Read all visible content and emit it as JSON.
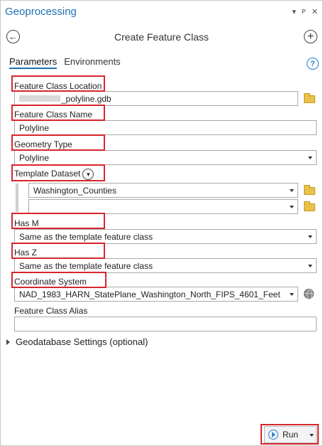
{
  "window": {
    "title": "Geoprocessing",
    "controls": [
      "▾",
      "ᴘ",
      "✕"
    ]
  },
  "header": {
    "tool_title": "Create Feature Class"
  },
  "tabs": [
    {
      "label": "Parameters",
      "active": true
    },
    {
      "label": "Environments",
      "active": false
    }
  ],
  "help_label": "?",
  "params": {
    "location_label": "Feature Class Location",
    "location_value": "_polyline.gdb",
    "name_label": "Feature Class Name",
    "name_value": "Polyline",
    "geometry_label": "Geometry Type",
    "geometry_value": "Polyline",
    "template_label": "Template Dataset",
    "template_values": [
      "Washington_Counties",
      ""
    ],
    "has_m_label": "Has M",
    "has_m_value": "Same as the template feature class",
    "has_z_label": "Has Z",
    "has_z_value": "Same as the template feature class",
    "coord_label": "Coordinate System",
    "coord_value": "NAD_1983_HARN_StatePlane_Washington_North_FIPS_4601_Feet",
    "alias_label": "Feature Class Alias",
    "alias_value": ""
  },
  "section_label": "Geodatabase Settings (optional)",
  "run_label": "Run",
  "colors": {
    "accent": "#1f6fb6",
    "highlight": "#d7262d"
  }
}
